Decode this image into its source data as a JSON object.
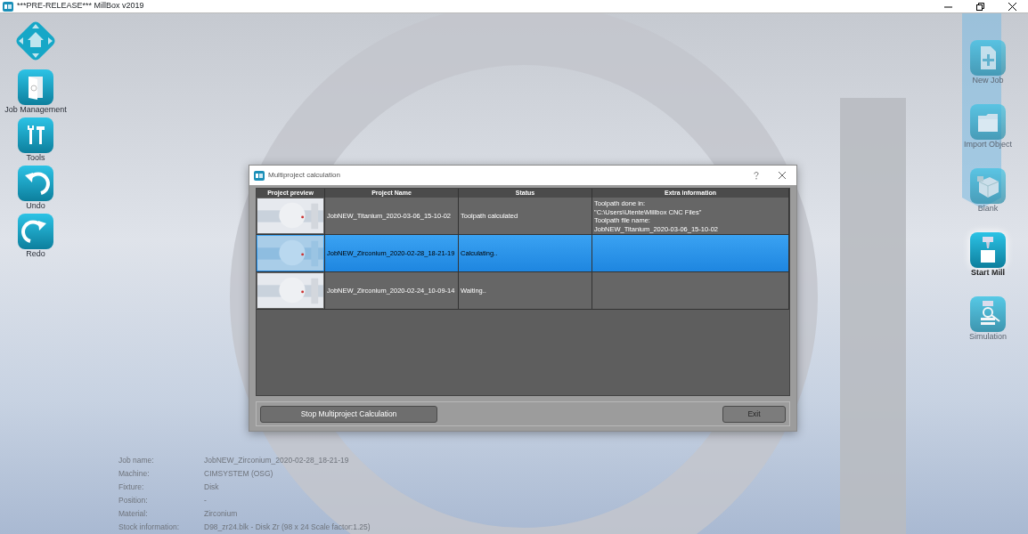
{
  "window": {
    "title": "***PRE-RELEASE*** MillBox v2019"
  },
  "left_toolbar": [
    {
      "kind": "home"
    },
    {
      "kind": "job-management",
      "label": "Job Management"
    },
    {
      "kind": "tools",
      "label": "Tools"
    },
    {
      "kind": "undo",
      "label": "Undo"
    },
    {
      "kind": "redo",
      "label": "Redo"
    }
  ],
  "right_toolbar": [
    {
      "kind": "new-job",
      "label": "New Job",
      "selected": false
    },
    {
      "kind": "import",
      "label": "Import Object",
      "selected": false
    },
    {
      "kind": "blank",
      "label": "Blank",
      "selected": false
    },
    {
      "kind": "start-mill",
      "label": "Start Mill",
      "selected": true
    },
    {
      "kind": "simulation",
      "label": "Simulation",
      "selected": false
    }
  ],
  "job_info": [
    {
      "label": "Job name:",
      "value": "JobNEW_Zirconium_2020-02-28_18-21-19"
    },
    {
      "label": "Machine:",
      "value": "CIMSYSTEM (OSG)"
    },
    {
      "label": "Fixture:",
      "value": "Disk"
    },
    {
      "label": "Position:",
      "value": "-"
    },
    {
      "label": "Material:",
      "value": "Zirconium"
    },
    {
      "label": "Stock information:",
      "value": "D98_zr24.blk - Disk Zr (98 x 24 Scale factor:1.25)"
    }
  ],
  "dialog": {
    "title": "Multiproject calculation",
    "columns": [
      "Project preview",
      "Project Name",
      "Status",
      "Extra information"
    ],
    "rows": [
      {
        "preview": {
          "kind": "picture"
        },
        "name": "JobNEW_Titanium_2020-03-06_15-10-02",
        "status": "Toolpath calculated",
        "extra_information": [
          "Toolpath done in:",
          "\"C:\\Users\\Utente\\Millbox CNC Files\"",
          "Toolpath file name:",
          "JobNEW_Titanium_2020-03-06_15-10-02"
        ],
        "selected": false
      },
      {
        "preview": {
          "kind": "picture"
        },
        "name": "JobNEW_Zirconium_2020-02-28_18-21-19",
        "status": "Calculating..",
        "selected": true
      },
      {
        "preview": {
          "kind": "picture"
        },
        "name": "JobNEW_Zirconium_2020-02-24_10-09-14",
        "status": "Waiting..",
        "selected": false
      }
    ],
    "buttons": [
      {
        "label": "Stop Multiproject Calculation",
        "disabled": false
      },
      {
        "label": "Exit",
        "disabled": true
      }
    ]
  }
}
